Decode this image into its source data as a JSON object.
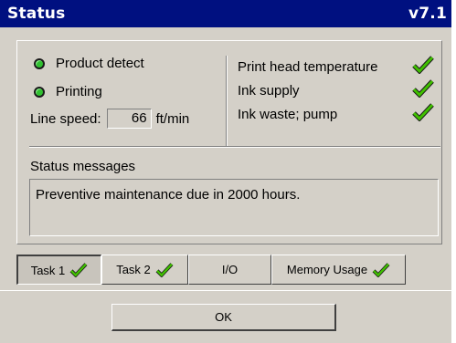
{
  "window": {
    "title": "Status",
    "version": "v7.1",
    "titlebar_color": "#001080"
  },
  "status_indicators": [
    {
      "label": "Product detect",
      "state": "on",
      "color": "#30c030"
    },
    {
      "label": "Printing",
      "state": "on",
      "color": "#30c030"
    }
  ],
  "line_speed": {
    "label": "Line speed:",
    "value": "66",
    "unit": "ft/min"
  },
  "checks": [
    {
      "label": "Print head temperature",
      "ok": true,
      "icon": "checkmark-icon"
    },
    {
      "label": "Ink supply",
      "ok": true,
      "icon": "checkmark-icon"
    },
    {
      "label": "Ink waste; pump",
      "ok": true,
      "icon": "checkmark-icon"
    }
  ],
  "messages": {
    "label": "Status messages",
    "text": "Preventive maintenance due in 2000 hours."
  },
  "tabs": [
    {
      "label": "Task 1",
      "has_check": true,
      "active": true
    },
    {
      "label": "Task 2",
      "has_check": true,
      "active": false
    },
    {
      "label": "I/O",
      "has_check": false,
      "active": false
    },
    {
      "label": "Memory Usage",
      "has_check": true,
      "active": false
    }
  ],
  "ok_button": {
    "label": "OK"
  },
  "check_color": "#40c000"
}
